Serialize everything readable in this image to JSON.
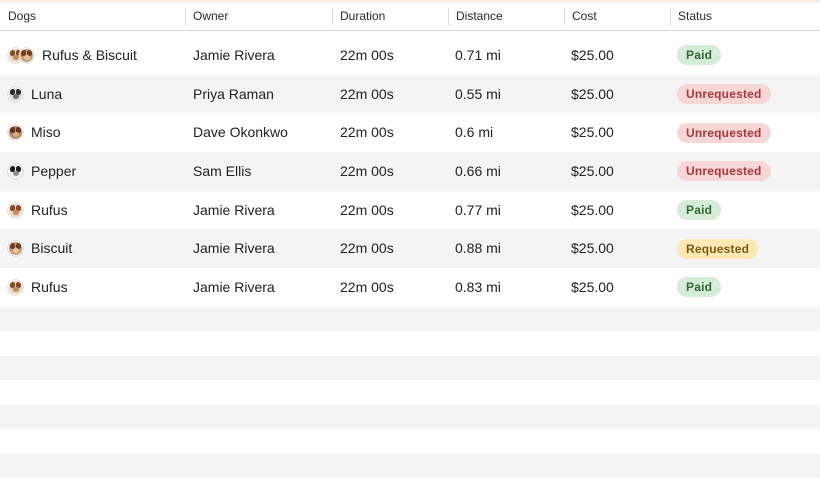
{
  "columns": {
    "dogs": "Dogs",
    "owner": "Owner",
    "duration": "Duration",
    "distance": "Distance",
    "cost": "Cost",
    "status": "Status"
  },
  "status_styles": {
    "Paid": {
      "bg": "#d5ecd6",
      "fg": "#2f6b33"
    },
    "Unrequested": {
      "bg": "#f7d6d6",
      "fg": "#a8383b"
    },
    "Requested": {
      "bg": "#fbe8b5",
      "fg": "#7a5a0e"
    }
  },
  "rows": [
    {
      "dogs": "Rufus & Biscuit",
      "avatars": [
        "rufus-avatar-icon",
        "biscuit-avatar-icon"
      ],
      "owner": "Jamie Rivera",
      "duration": "22m 00s",
      "distance": "0.71 mi",
      "cost": "$25.00",
      "status": "Paid"
    },
    {
      "dogs": "Luna",
      "avatars": [
        "luna-avatar-icon"
      ],
      "owner": "Priya Raman",
      "duration": "22m 00s",
      "distance": "0.55 mi",
      "cost": "$25.00",
      "status": "Unrequested"
    },
    {
      "dogs": "Miso",
      "avatars": [
        "miso-avatar-icon"
      ],
      "owner": "Dave Okonkwo",
      "duration": "22m 00s",
      "distance": "0.6 mi",
      "cost": "$25.00",
      "status": "Unrequested"
    },
    {
      "dogs": "Pepper",
      "avatars": [
        "pepper-avatar-icon"
      ],
      "owner": "Sam Ellis",
      "duration": "22m 00s",
      "distance": "0.66 mi",
      "cost": "$25.00",
      "status": "Unrequested"
    },
    {
      "dogs": "Rufus",
      "avatars": [
        "rufus-avatar-icon"
      ],
      "owner": "Jamie Rivera",
      "duration": "22m 00s",
      "distance": "0.77 mi",
      "cost": "$25.00",
      "status": "Paid"
    },
    {
      "dogs": "Biscuit",
      "avatars": [
        "biscuit-avatar-icon"
      ],
      "owner": "Jamie Rivera",
      "duration": "22m 00s",
      "distance": "0.88 mi",
      "cost": "$25.00",
      "status": "Requested"
    },
    {
      "dogs": "Rufus",
      "avatars": [
        "rufus-avatar-icon"
      ],
      "owner": "Jamie Rivera",
      "duration": "22m 00s",
      "distance": "0.83 mi",
      "cost": "$25.00",
      "status": "Paid"
    }
  ],
  "avatar_palette": {
    "rufus-avatar-icon": {
      "bg": "#e8d3bf",
      "ear": "#8a4a22",
      "snout": "#c98a55"
    },
    "biscuit-avatar-icon": {
      "bg": "#c99a72",
      "ear": "#6e3f1f",
      "snout": "#e7c59e"
    },
    "luna-avatar-icon": {
      "bg": "#d9dde0",
      "ear": "#2b2b2b",
      "snout": "#6c6c6c"
    },
    "miso-avatar-icon": {
      "bg": "#b88562",
      "ear": "#5e3318",
      "snout": "#d9ad86"
    },
    "pepper-avatar-icon": {
      "bg": "#efefef",
      "ear": "#1f1f1f",
      "snout": "#8e8e8e"
    }
  }
}
